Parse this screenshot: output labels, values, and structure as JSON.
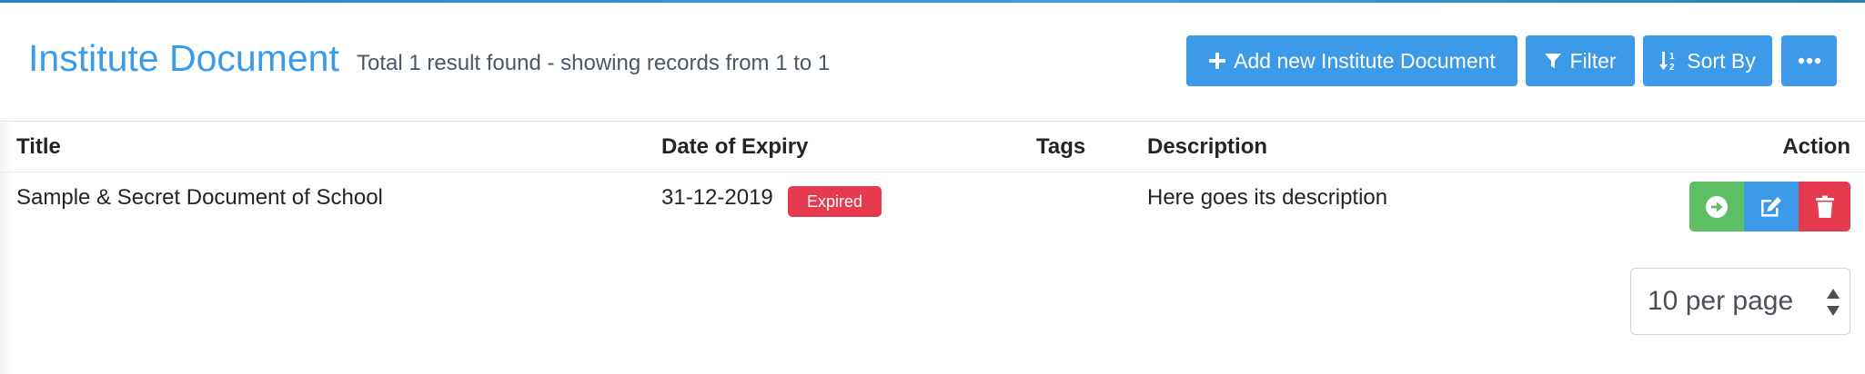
{
  "header": {
    "title": "Institute Document",
    "result_info": "Total 1 result found - showing records from 1 to 1",
    "buttons": {
      "add_label": "Add new Institute Document",
      "filter_label": "Filter",
      "sort_label": "Sort By"
    }
  },
  "table": {
    "columns": [
      "Title",
      "Date of Expiry",
      "Tags",
      "Description",
      "Action"
    ],
    "rows": [
      {
        "title": "Sample & Secret Document of School",
        "date_of_expiry": "31-12-2019",
        "status_badge": "Expired",
        "tags": "",
        "description": "Here goes its description"
      }
    ]
  },
  "pagination": {
    "per_page_selected": "10 per page"
  },
  "colors": {
    "primary": "#3d9ae8",
    "success": "#5cbf63",
    "danger": "#e63a4f",
    "title": "#3a9be8"
  },
  "icons": [
    "plus-icon",
    "filter-icon",
    "sort-numeric-icon",
    "ellipsis-icon",
    "arrow-circle-right-icon",
    "edit-icon",
    "trash-icon",
    "select-arrows-icon"
  ]
}
